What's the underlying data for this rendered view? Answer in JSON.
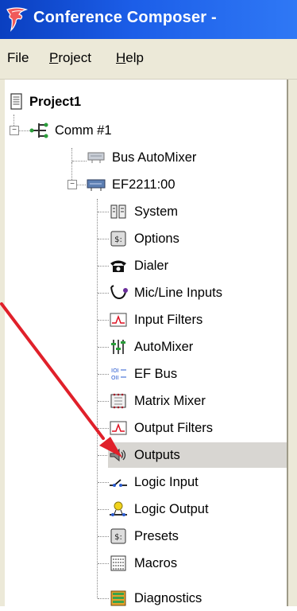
{
  "window": {
    "title": "Conference Composer -"
  },
  "menu": {
    "items": [
      {
        "label": "File"
      },
      {
        "label": "Project",
        "mnemonic": "P"
      },
      {
        "label": "Help",
        "mnemonic": "H"
      }
    ]
  },
  "tree": {
    "project": "Project1",
    "comm": "Comm #1",
    "bus_automixer": "Bus AutoMixer",
    "device": "EF2211:00",
    "children": [
      {
        "label": "System",
        "icon": "system-icon"
      },
      {
        "label": "Options",
        "icon": "options-icon"
      },
      {
        "label": "Dialer",
        "icon": "phone-icon"
      },
      {
        "label": "Mic/Line Inputs",
        "icon": "mic-icon"
      },
      {
        "label": "Input Filters",
        "icon": "filter-icon"
      },
      {
        "label": "AutoMixer",
        "icon": "faders-icon"
      },
      {
        "label": "EF Bus",
        "icon": "bus-icon"
      },
      {
        "label": "Matrix Mixer",
        "icon": "matrix-icon"
      },
      {
        "label": "Output Filters",
        "icon": "filter-icon"
      },
      {
        "label": "Outputs",
        "icon": "speaker-icon",
        "selected": true
      },
      {
        "label": "Logic Input",
        "icon": "logic-input-icon"
      },
      {
        "label": "Logic Output",
        "icon": "logic-output-icon"
      },
      {
        "label": "Presets",
        "icon": "presets-icon"
      },
      {
        "label": "Macros",
        "icon": "macros-icon"
      },
      {
        "label": "Diagnostics",
        "icon": "diagnostics-icon"
      }
    ]
  },
  "colors": {
    "titlebar": "#1c5ee8",
    "menubar": "#ece9d8",
    "selection": "#d8d6d2",
    "arrow": "#e0202a"
  }
}
